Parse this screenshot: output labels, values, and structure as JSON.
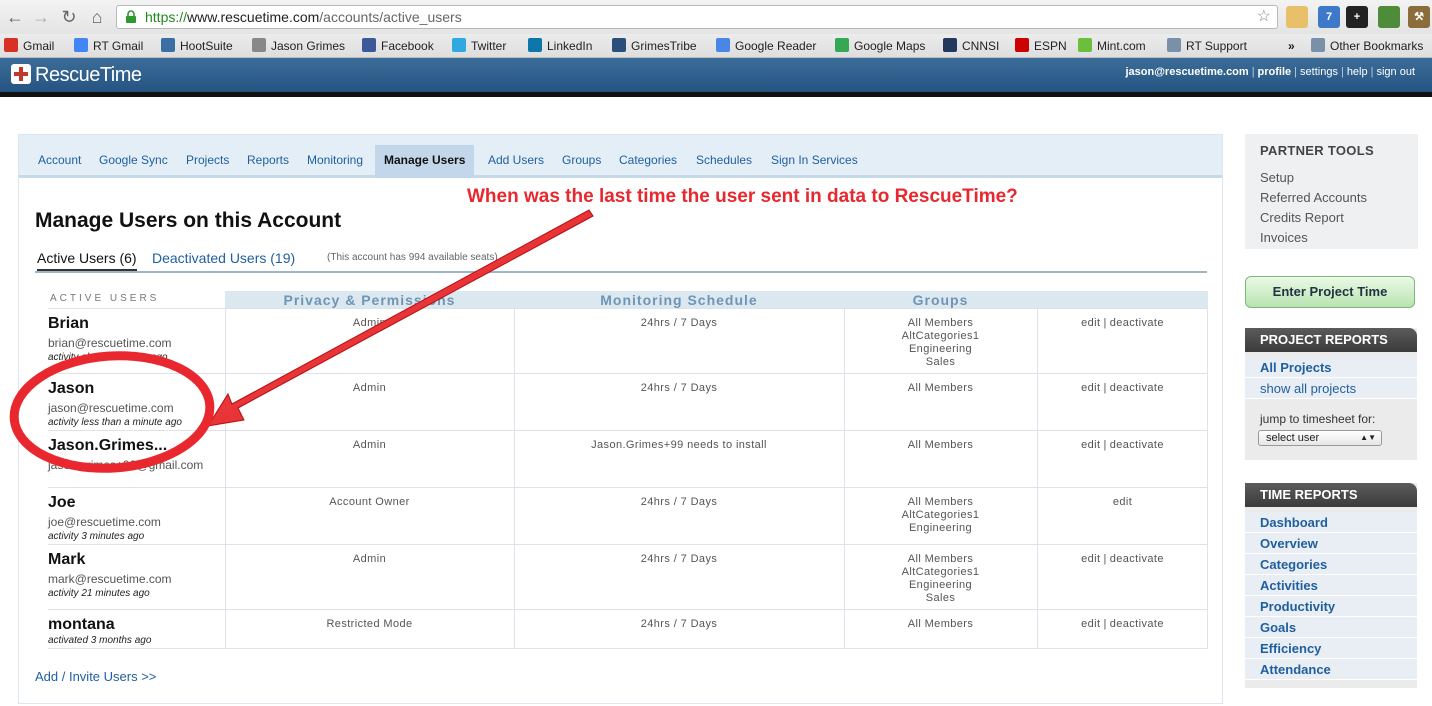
{
  "browser": {
    "url_scheme": "https://",
    "url_host": "www.rescuetime.com",
    "url_path": "/accounts/active_users",
    "bookmarks": [
      {
        "label": "Gmail",
        "color": "#d93025"
      },
      {
        "label": "RT Gmail",
        "color": "#4285f4"
      },
      {
        "label": "HootSuite",
        "color": "#3b6ea5"
      },
      {
        "label": "Jason Grimes",
        "color": "#888888"
      },
      {
        "label": "Facebook",
        "color": "#3b5998"
      },
      {
        "label": "Twitter",
        "color": "#2fa9e0"
      },
      {
        "label": "LinkedIn",
        "color": "#0e76a8"
      },
      {
        "label": "GrimesTribe",
        "color": "#2a4f7a"
      },
      {
        "label": "Google Reader",
        "color": "#4a86e8"
      },
      {
        "label": "Google Maps",
        "color": "#34a853"
      },
      {
        "label": "CNNSI",
        "color": "#22385c"
      },
      {
        "label": "ESPN",
        "color": "#cc0000"
      },
      {
        "label": "Mint.com",
        "color": "#6cbf3d"
      },
      {
        "label": "RT Support",
        "color": "#7a8fa8"
      }
    ],
    "overflow": "»",
    "other_bookmarks": "Other Bookmarks"
  },
  "header": {
    "logo": "RescueTime",
    "user_email": "jason@rescuetime.com",
    "links": [
      "profile",
      "settings",
      "help",
      "sign out"
    ]
  },
  "tabs": [
    "Account",
    "Google Sync",
    "Projects",
    "Reports",
    "Monitoring",
    "Manage Users",
    "Add Users",
    "Groups",
    "Categories",
    "Schedules",
    "Sign In Services"
  ],
  "active_tab": "Manage Users",
  "page_title": "Manage Users on this Account",
  "subtabs": {
    "active": "Active Users (6)",
    "deactivated": "Deactivated Users (19)",
    "seats_note": "(This account has 994 available seats)"
  },
  "table": {
    "active_users_label": "ACTIVE USERS",
    "headers": [
      "Privacy & Permissions",
      "Monitoring Schedule",
      "Groups"
    ],
    "rows": [
      {
        "name": "Brian",
        "email": "brian@rescuetime.com",
        "activity": "activity about 21 hours ago",
        "permission": "Admin",
        "schedule": "24hrs / 7 Days",
        "groups": "All Members\nAltCategories1\nEngineering\nSales",
        "edit": "edit",
        "deactivate": "deactivate"
      },
      {
        "name": "Jason",
        "email": "jason@rescuetime.com",
        "activity": "activity less than a minute ago",
        "permission": "Admin",
        "schedule": "24hrs / 7 Days",
        "groups": "All Members",
        "edit": "edit",
        "deactivate": "deactivate"
      },
      {
        "name": "Jason.Grimes...",
        "email": "jason.grimes+99@gmail.com",
        "activity": "",
        "permission": "Admin",
        "schedule": "Jason.Grimes+99 needs to install",
        "groups": "All Members",
        "edit": "edit",
        "deactivate": "deactivate"
      },
      {
        "name": "Joe",
        "email": "joe@rescuetime.com",
        "activity": "activity 3 minutes ago",
        "permission": "Account Owner",
        "schedule": "24hrs / 7 Days",
        "groups": "All Members\nAltCategories1\nEngineering",
        "edit": "edit",
        "deactivate": ""
      },
      {
        "name": "Mark",
        "email": "mark@rescuetime.com",
        "activity": "activity 21 minutes ago",
        "permission": "Admin",
        "schedule": "24hrs / 7 Days",
        "groups": "All Members\nAltCategories1\nEngineering\nSales",
        "edit": "edit",
        "deactivate": "deactivate"
      },
      {
        "name": "montana",
        "email": "",
        "activity": "activated 3 months ago",
        "permission": "Restricted Mode",
        "schedule": "24hrs / 7 Days",
        "groups": "All Members",
        "edit": "edit",
        "deactivate": "deactivate"
      }
    ]
  },
  "invite_link": "Add / Invite Users >>",
  "annotation": "When was the last time the user sent in data to RescueTime?",
  "sidebar": {
    "partner_tools": {
      "title": "PARTNER TOOLS",
      "links": [
        "Setup",
        "Referred Accounts",
        "Credits Report",
        "Invoices"
      ]
    },
    "enter_project_time": "Enter Project Time",
    "project_reports": {
      "title": "PROJECT REPORTS",
      "items": [
        "All Projects",
        "show all projects"
      ],
      "jump_label": "jump to timesheet for:",
      "select_value": "select user"
    },
    "time_reports": {
      "title": "TIME REPORTS",
      "items": [
        "Dashboard",
        "Overview",
        "Categories",
        "Activities",
        "Productivity",
        "Goals",
        "Efficiency",
        "Attendance"
      ]
    }
  },
  "colors": {
    "header_blue": "#255482",
    "link_blue": "#1f5f9f",
    "annotation_red": "#e8282e"
  }
}
